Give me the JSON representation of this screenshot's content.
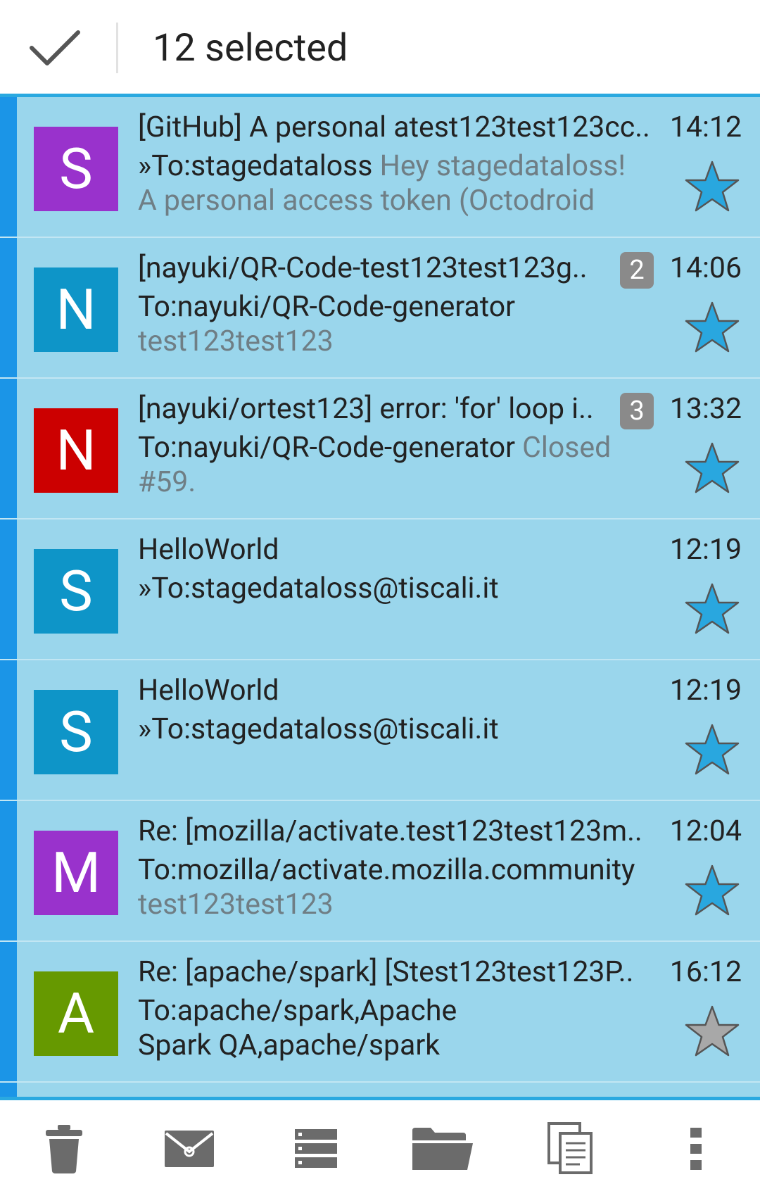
{
  "action_bar": {
    "selected_text": "12 selected"
  },
  "colors": {
    "row_background": "#9ad6ec",
    "selection_bar": "#1b95e7",
    "star_favorite": "#29a7df",
    "star_normal": "#a8a8a8",
    "snippet_text": "#6f7e85",
    "badge": "#8a8a8a"
  },
  "messages": [
    {
      "avatar_letter": "S",
      "avatar_color": "#9932cc",
      "subject": "[GitHub] A personal atest123test123cc..",
      "time": "14:12",
      "thread_count": "",
      "recipients": "»To:stagedataloss",
      "snippet": " Hey stagedataloss! A personal access token (Octodroid",
      "starred": true
    },
    {
      "avatar_letter": "N",
      "avatar_color": "#0e95c8",
      "subject": "[nayuki/QR-Code-test123test123g..",
      "time": "14:06",
      "thread_count": "2",
      "recipients": "To:nayuki/QR-Code-generator",
      "snippet": " test123test123",
      "starred": true
    },
    {
      "avatar_letter": "N",
      "avatar_color": "#cc0000",
      "subject": "[nayuki/ortest123] error: 'for' loop i..",
      "time": "13:32",
      "thread_count": "3",
      "recipients": "To:nayuki/QR-Code-generator",
      "snippet": " Closed #59.",
      "starred": true
    },
    {
      "avatar_letter": "S",
      "avatar_color": "#0e95c8",
      "subject": "HelloWorld",
      "time": "12:19",
      "thread_count": "",
      "recipients": "»To:stagedataloss@tiscali.it",
      "snippet": "",
      "starred": true
    },
    {
      "avatar_letter": "S",
      "avatar_color": "#0e95c8",
      "subject": "HelloWorld",
      "time": "12:19",
      "thread_count": "",
      "recipients": "»To:stagedataloss@tiscali.it",
      "snippet": "",
      "starred": true
    },
    {
      "avatar_letter": "M",
      "avatar_color": "#9932cc",
      "subject": "Re: [mozilla/activate.test123test123m..",
      "time": "12:04",
      "thread_count": "",
      "recipients": "To:mozilla/activate.mozilla.community",
      "snippet": " test123test123",
      "starred": true
    },
    {
      "avatar_letter": "A",
      "avatar_color": "#669900",
      "subject": "Re: [apache/spark] [Stest123test123P..",
      "time": "16:12",
      "thread_count": "",
      "recipients": "To:apache/spark,Apache Spark QA,apache/spark",
      "snippet": "",
      "starred": false
    }
  ],
  "toolbar": {
    "actions": [
      "delete-icon",
      "mark-read-icon",
      "move-icon",
      "folder-icon",
      "copy-icon",
      "overflow-menu-icon"
    ]
  }
}
